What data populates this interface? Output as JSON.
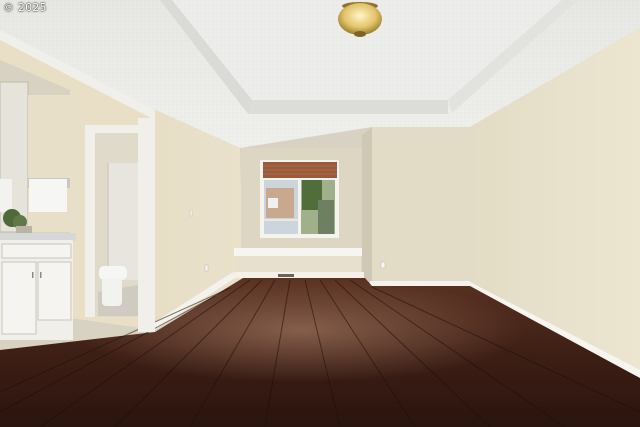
{
  "watermark": {
    "copyright_symbol": "©",
    "year": "2025"
  },
  "palette": {
    "ceiling": "#e9e9e6",
    "wall_left": "#e6ddc3",
    "wall_right": "#e7dfc9",
    "wall_back": "#ddd6c2",
    "floor_dark": "#2e1610",
    "floor_mid": "#4e2a1e",
    "baseboard": "#f4f2ec",
    "vanity": "#f0efea",
    "countertop": "#d6d8d8"
  },
  "icons": [
    "ceiling-light-icon",
    "toilet-icon",
    "vanity-cabinet-icon",
    "window-blind-icon"
  ]
}
